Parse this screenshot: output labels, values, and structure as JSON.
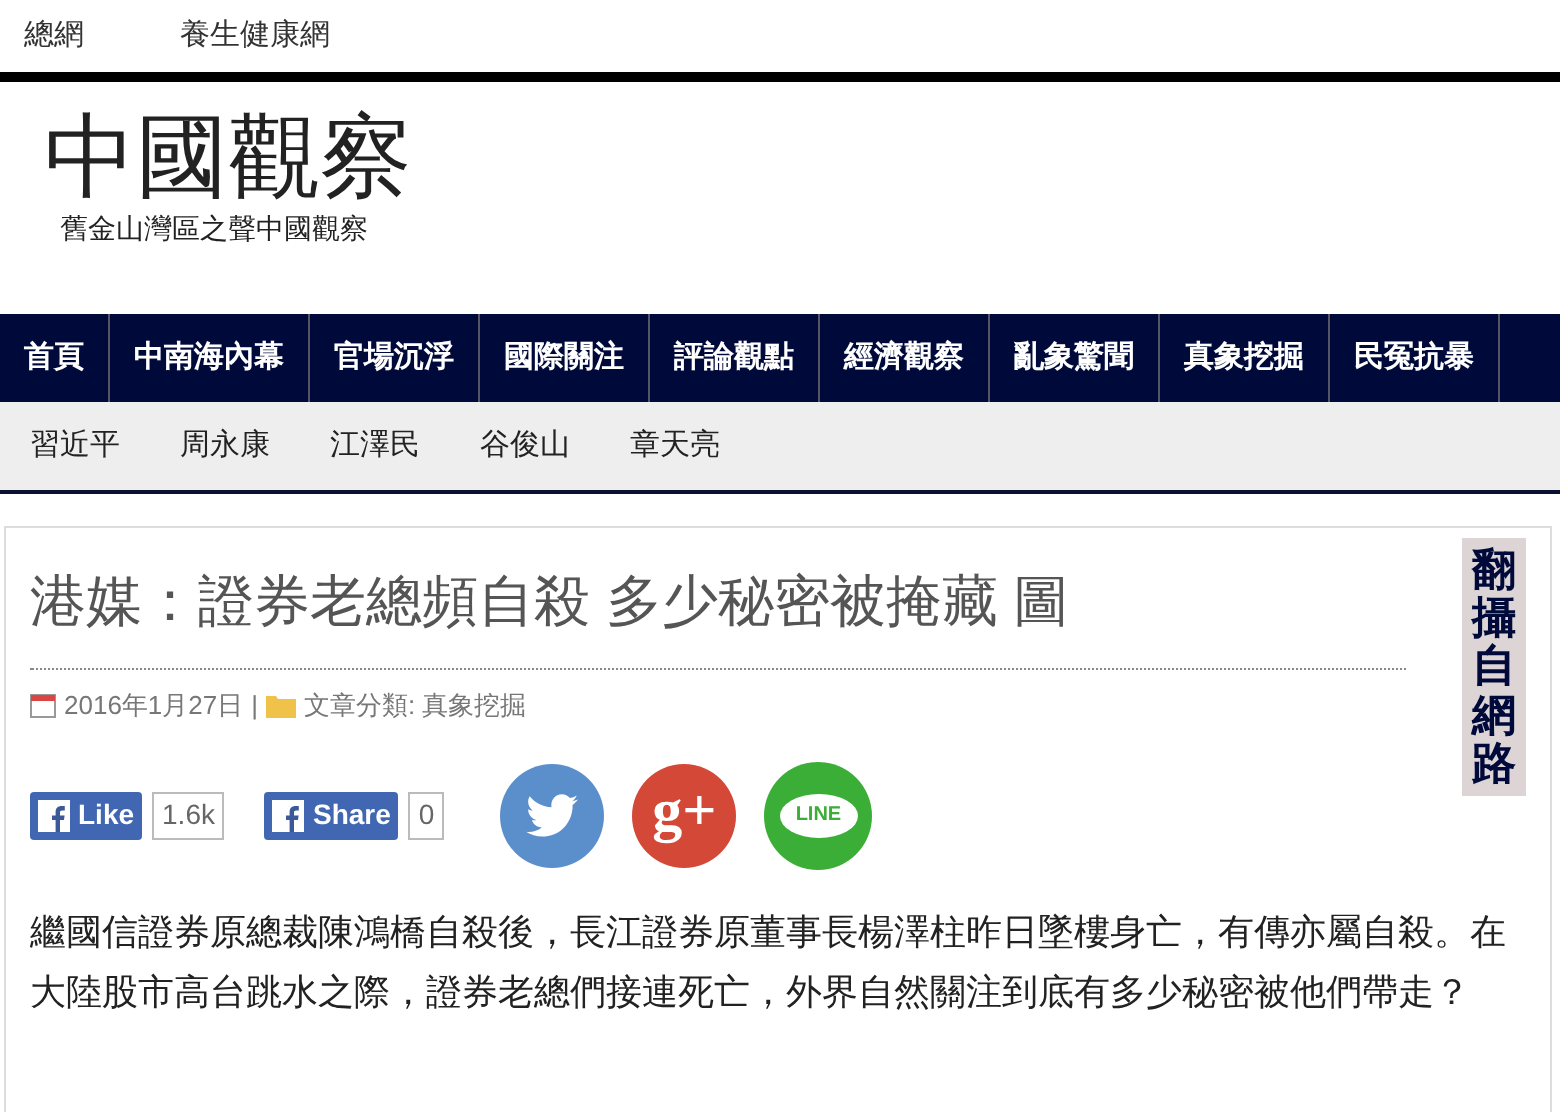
{
  "top_links": [
    "總網",
    "養生健康網"
  ],
  "site": {
    "title": "中國觀察",
    "subtitle": "舊金山灣區之聲中國觀察"
  },
  "nav": [
    "首頁",
    "中南海內幕",
    "官場沉浮",
    "國際關注",
    "評論觀點",
    "經濟觀察",
    "亂象驚聞",
    "真象挖掘",
    "民冤抗暴"
  ],
  "subnav": [
    "習近平",
    "周永康",
    "江澤民",
    "谷俊山",
    "章天亮"
  ],
  "article": {
    "title": "港媒：證券老總頻自殺 多少秘密被掩藏 圖",
    "date": "2016年1月27日",
    "separator": "|",
    "category": "文章分類: 真象挖掘",
    "side_label": "翻攝自網路",
    "share": [
      {
        "kind": "facebook",
        "label": "Like",
        "count": "1.6k"
      },
      {
        "kind": "facebook",
        "label": "Share",
        "count": "0"
      }
    ],
    "social": [
      {
        "kind": "twitter"
      },
      {
        "kind": "google",
        "label": "g+"
      },
      {
        "kind": "line",
        "label": "LINE"
      }
    ],
    "body": "繼國信證券原總裁陳鴻橋自殺後，長江證券原董事長楊澤柱昨日墜樓身亡，有傳亦屬自殺。在大陸股市高台跳水之際，證券老總們接連死亡，外界自然關注到底有多少秘密被他們帶走？"
  }
}
